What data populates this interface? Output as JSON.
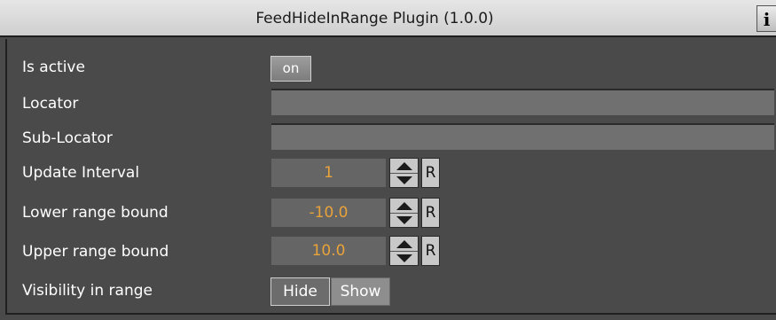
{
  "window": {
    "title": "FeedHideInRange Plugin (1.0.0)",
    "info_label": "i"
  },
  "fields": {
    "is_active": {
      "label": "Is active",
      "value": "on"
    },
    "locator": {
      "label": "Locator",
      "value": ""
    },
    "sub_locator": {
      "label": "Sub-Locator",
      "value": ""
    },
    "update_interval": {
      "label": "Update Interval",
      "value": "1",
      "reset_label": "R"
    },
    "lower_range_bound": {
      "label": "Lower range bound",
      "value": "-10.0",
      "reset_label": "R"
    },
    "upper_range_bound": {
      "label": "Upper range bound",
      "value": "10.0",
      "reset_label": "R"
    },
    "visibility_in_range": {
      "label": "Visibility in range",
      "options": [
        "Hide",
        "Show"
      ],
      "selected": "Hide"
    }
  },
  "colors": {
    "value_text": "#e8a33a",
    "panel_bg": "#4a4a4a"
  },
  "icons": {
    "stepper_up": "triangle-up-icon",
    "stepper_down": "triangle-down-icon"
  }
}
